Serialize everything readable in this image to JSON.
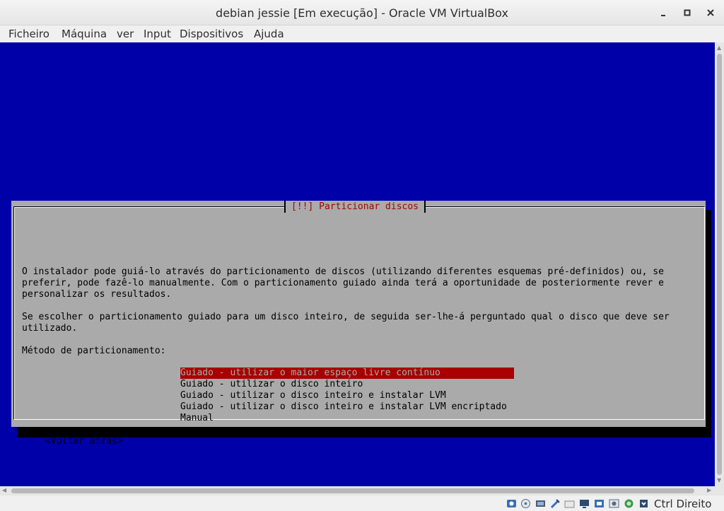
{
  "window": {
    "title": "debian jessie [Em execução] - Oracle VM VirtualBox"
  },
  "menu": {
    "items": [
      "Ficheiro",
      "Máquina",
      "ver",
      "Input",
      "Dispositivos",
      "Ajuda"
    ]
  },
  "installer": {
    "dialog_title": "[!!] Particionar discos",
    "paragraph_1": "O instalador pode guiá-lo através do particionamento de discos (utilizando diferentes esquemas pré-definidos) ou, se\npreferir, pode fazê-lo manualmente. Com o particionamento guiado ainda terá a oportunidade de posteriormente rever e\npersonalizar os resultados.",
    "paragraph_2": "Se escolher o particionamento guiado para um disco inteiro, de seguida ser-lhe-á perguntado qual o disco que deve ser\nutilizado.",
    "method_label": "Método de particionamento:",
    "options": [
      "Guiado - utilizar o maior espaço livre contínuo",
      "Guiado - utilizar o disco inteiro",
      "Guiado - utilizar o disco inteiro e instalar LVM",
      "Guiado - utilizar o disco inteiro e instalar LVM encriptado",
      "Manual"
    ],
    "selected_option": "Guiado - utilizar o maior espaço livre contínuo",
    "back_button": "<Voltar atrás>"
  },
  "colors": {
    "vm_background": "#0000a8",
    "dialog_background": "#aaaaaa",
    "title_red": "#a80000",
    "selection": "#a80000"
  },
  "statusbar": {
    "icons": [
      "hard-disk-icon",
      "optical-drive-icon",
      "audio-icon",
      "network-icon",
      "shared-folders-icon",
      "display-icon",
      "video-capture-icon",
      "recording-icon",
      "mouse-integration-icon",
      "usb-icon",
      "host-key-arrow-icon"
    ],
    "host_key": "Ctrl Direito"
  }
}
